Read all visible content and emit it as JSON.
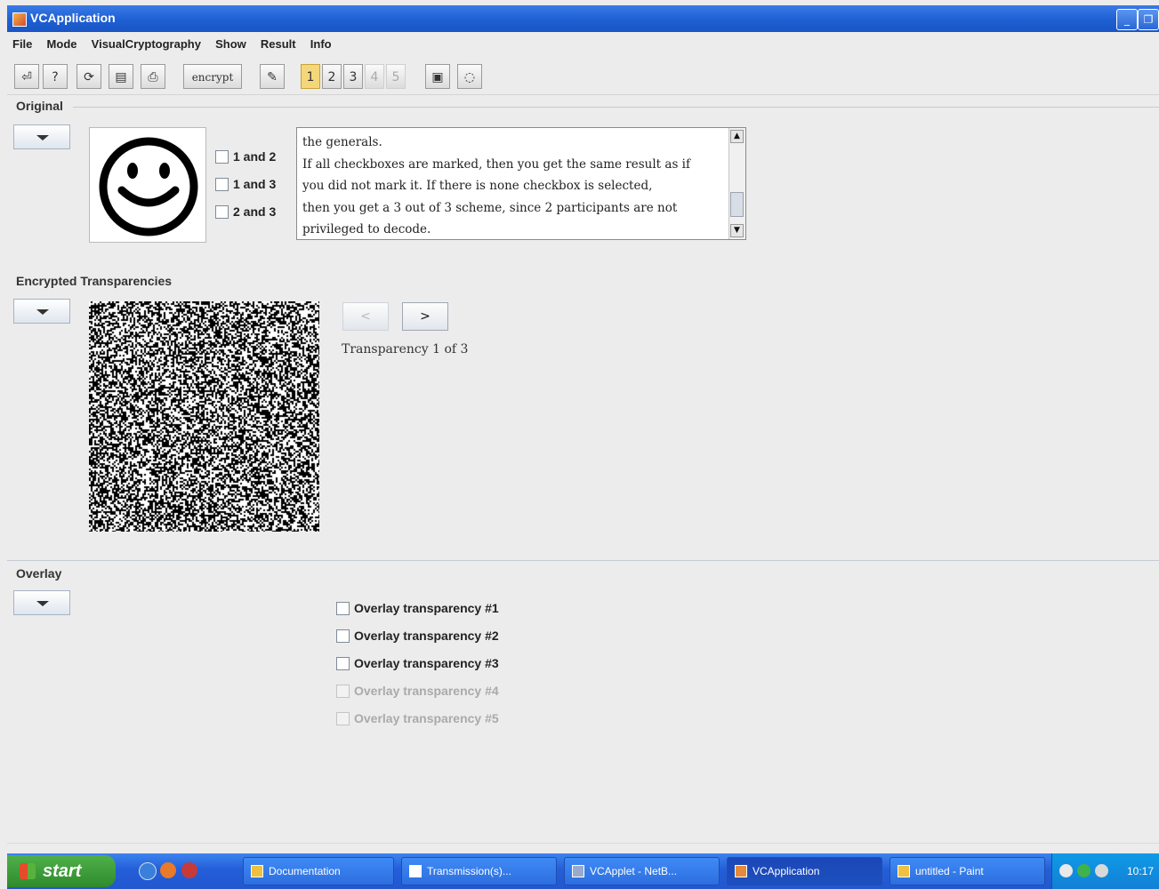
{
  "window": {
    "title": "VCApplication"
  },
  "menu": [
    "File",
    "Mode",
    "VisualCryptography",
    "Show",
    "Result",
    "Info"
  ],
  "toolbar": {
    "encrypt_label": "encrypt",
    "pages": [
      "1",
      "2",
      "3",
      "4",
      "5"
    ],
    "icons": [
      "exit-icon",
      "help-icon",
      "refresh-icon",
      "save-icon",
      "print-icon",
      "encrypt-button",
      "tools-icon",
      "page-1",
      "page-2",
      "page-3",
      "page-4",
      "page-5",
      "document-icon",
      "chat-icon"
    ]
  },
  "original": {
    "label": "Original",
    "checkboxes": [
      "1 and 2",
      "1 and 3",
      "2 and 3"
    ],
    "description": "the generals.\nIf all checkboxes are marked, then you get the same result as if\nyou did not mark it. If there is none checkbox is selected,\nthen you get a 3 out of 3 scheme, since 2 participants are not\nprivileged to decode."
  },
  "encrypted": {
    "label": "Encrypted Transparencies",
    "prev_label": "<",
    "next_label": ">",
    "status": "Transparency 1 of 3"
  },
  "overlay": {
    "label": "Overlay",
    "items": [
      {
        "label": "Overlay transparency #1",
        "enabled": true
      },
      {
        "label": "Overlay transparency #2",
        "enabled": true
      },
      {
        "label": "Overlay transparency #3",
        "enabled": true
      },
      {
        "label": "Overlay transparency #4",
        "enabled": false
      },
      {
        "label": "Overlay transparency #5",
        "enabled": false
      }
    ]
  },
  "taskbar": {
    "start_label": "start",
    "tasks": [
      "Documentation",
      "Transmission(s)...",
      "VCApplet - NetB...",
      "VCApplication",
      "untitled - Paint"
    ],
    "clock": "10:17"
  }
}
